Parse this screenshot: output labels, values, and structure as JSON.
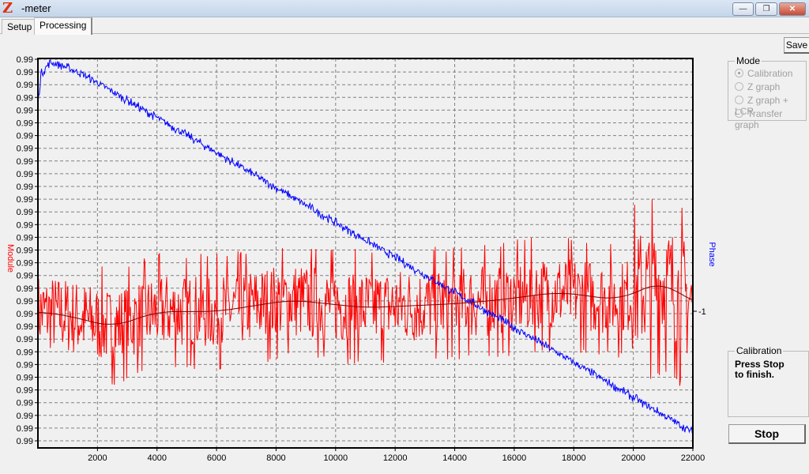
{
  "window": {
    "title": "-meter",
    "logo": "Z",
    "buttons": {
      "minimize": "—",
      "maximize": "❐",
      "close": "✕"
    }
  },
  "tabs": [
    {
      "label": "Setup",
      "active": false
    },
    {
      "label": "Processing",
      "active": true
    }
  ],
  "save_label": "Save",
  "mode": {
    "title": "Mode",
    "options": [
      {
        "label": "Calibration",
        "selected": true
      },
      {
        "label": "Z graph",
        "selected": false
      },
      {
        "label": "Z graph + LCR",
        "selected": false
      },
      {
        "label": "Transfer graph",
        "selected": false
      }
    ]
  },
  "calibration": {
    "title": "Calibration",
    "message_line1": "Press Stop",
    "message_line2": "to finish."
  },
  "stop_label": "Stop",
  "colors": {
    "module": "#ff0000",
    "phase": "#0000ff",
    "module_avg": "#800000",
    "grid": "#808080"
  },
  "chart_data": {
    "type": "line",
    "xlabel": "",
    "ylabel_left": "Module",
    "ylabel_right": "Phase",
    "xlim": [
      0,
      22000
    ],
    "ylim": [
      0,
      1
    ],
    "x_ticks": [
      2000,
      4000,
      6000,
      8000,
      10000,
      12000,
      14000,
      16000,
      18000,
      20000,
      22000
    ],
    "y_tick_label": "0.99",
    "y_tick_count": 31,
    "right_tick": {
      "label": "-1",
      "value": 0.35
    },
    "grid": true,
    "series": [
      {
        "name": "Phase",
        "color": "#0000ff",
        "noise": 0.008,
        "points": [
          [
            0,
            0.88
          ],
          [
            100,
            0.96
          ],
          [
            400,
            0.99
          ],
          [
            700,
            0.985
          ],
          [
            1500,
            0.96
          ],
          [
            22000,
            0.04
          ]
        ]
      },
      {
        "name": "Module",
        "color": "#ff0000",
        "noise": 0.1,
        "points": [
          [
            0,
            0.35
          ],
          [
            1000,
            0.34
          ],
          [
            2500,
            0.31
          ],
          [
            4000,
            0.35
          ],
          [
            6000,
            0.35
          ],
          [
            8500,
            0.38
          ],
          [
            11000,
            0.36
          ],
          [
            14000,
            0.37
          ],
          [
            15500,
            0.38
          ],
          [
            17500,
            0.4
          ],
          [
            19500,
            0.38
          ],
          [
            21000,
            0.43
          ],
          [
            22000,
            0.37
          ]
        ]
      },
      {
        "name": "Module average",
        "color": "#800000",
        "noise": 0,
        "points": [
          [
            0,
            0.35
          ],
          [
            1000,
            0.34
          ],
          [
            2500,
            0.31
          ],
          [
            4000,
            0.35
          ],
          [
            6000,
            0.35
          ],
          [
            8500,
            0.38
          ],
          [
            11000,
            0.36
          ],
          [
            14000,
            0.37
          ],
          [
            15500,
            0.38
          ],
          [
            17500,
            0.4
          ],
          [
            19500,
            0.38
          ],
          [
            21000,
            0.43
          ],
          [
            22000,
            0.37
          ]
        ]
      }
    ]
  }
}
